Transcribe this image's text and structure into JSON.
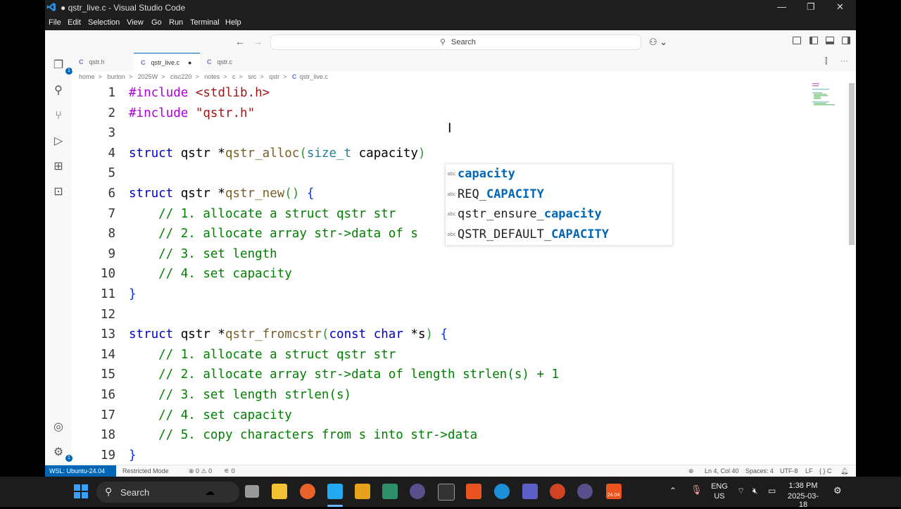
{
  "window": {
    "title": "● qstr_live.c - Visual Studio Code",
    "controls": {
      "minimize": "—",
      "restore": "❐",
      "close": "✕"
    }
  },
  "menu": [
    "File",
    "Edit",
    "Selection",
    "View",
    "Go",
    "Run",
    "Terminal",
    "Help"
  ],
  "command_center": {
    "back": "←",
    "forward": "→",
    "search_placeholder": "Search",
    "copilot": "⚇ ⌄"
  },
  "tabs": [
    {
      "icon": "C",
      "label": "qstr.h",
      "active": false,
      "dirty": false
    },
    {
      "icon": "C",
      "label": "qstr_live.c",
      "active": true,
      "dirty": true,
      "dirty_mark": "●"
    },
    {
      "icon": "C",
      "label": "qstr.c",
      "active": false,
      "dirty": false
    }
  ],
  "tab_actions": {
    "split": "⫿",
    "more": "···"
  },
  "breadcrumb": [
    "home",
    "burton",
    "2025W",
    "cisc220",
    "notes",
    "c",
    "src",
    "qstr",
    "qstr_live.c"
  ],
  "breadcrumb_file_icon": "C",
  "breadcrumb_sep": ">",
  "activity_badges": {
    "explorer": "1",
    "accounts_settings": "1"
  },
  "editor": {
    "lines": [
      {
        "n": "1",
        "text": "#include <stdlib.h>"
      },
      {
        "n": "2",
        "text": "#include \"qstr.h\""
      },
      {
        "n": "3",
        "text": ""
      },
      {
        "n": "4",
        "text": "struct qstr *qstr_alloc(size_t capacity)"
      },
      {
        "n": "5",
        "text": ""
      },
      {
        "n": "6",
        "text": "struct qstr *qstr_new() {"
      },
      {
        "n": "7",
        "text": "    // 1. allocate a struct qstr str"
      },
      {
        "n": "8",
        "text": "    // 2. allocate array str->data of s"
      },
      {
        "n": "9",
        "text": "    // 3. set length"
      },
      {
        "n": "10",
        "text": "    // 4. set capacity"
      },
      {
        "n": "11",
        "text": "}"
      },
      {
        "n": "12",
        "text": ""
      },
      {
        "n": "13",
        "text": "struct qstr *qstr_fromcstr(const char *s) {"
      },
      {
        "n": "14",
        "text": "    // 1. allocate a struct qstr str"
      },
      {
        "n": "15",
        "text": "    // 2. allocate array str->data of length strlen(s) + 1"
      },
      {
        "n": "16",
        "text": "    // 3. set length strlen(s)"
      },
      {
        "n": "17",
        "text": "    // 4. set capacity"
      },
      {
        "n": "18",
        "text": "    // 5. copy characters from s into str->data"
      },
      {
        "n": "19",
        "text": "}"
      }
    ]
  },
  "suggestions": [
    {
      "kind": "abc",
      "prefix": "",
      "match": "capacity",
      "selected": true
    },
    {
      "kind": "abc",
      "prefix": "REQ_",
      "match": "CAPACITY",
      "selected": false
    },
    {
      "kind": "abc",
      "prefix": "qstr_ensure_",
      "match": "capacity",
      "selected": false
    },
    {
      "kind": "abc",
      "prefix": "QSTR_DEFAULT_",
      "match": "CAPACITY",
      "selected": false
    }
  ],
  "statusbar": {
    "remote": "WSL: Ubuntu-24.04",
    "restricted": "Restricted Mode",
    "problems": "⊗ 0 ⚠ 0",
    "ports": "⚟ 0",
    "position": "Ln 4, Col 40",
    "spaces": "Spaces: 4",
    "encoding": "UTF-8",
    "eol": "LF",
    "language": "{ } C"
  },
  "taskbar": {
    "search_label": "Search",
    "lang_top": "ENG",
    "lang_bottom": "US",
    "time": "1:38 PM",
    "date": "2025-03-18",
    "ubuntu_badge": "24.04"
  },
  "colors": {
    "accent": "#0066b8",
    "titlebar": "#1e1e1e",
    "taskbar": "#1c1c1c"
  }
}
